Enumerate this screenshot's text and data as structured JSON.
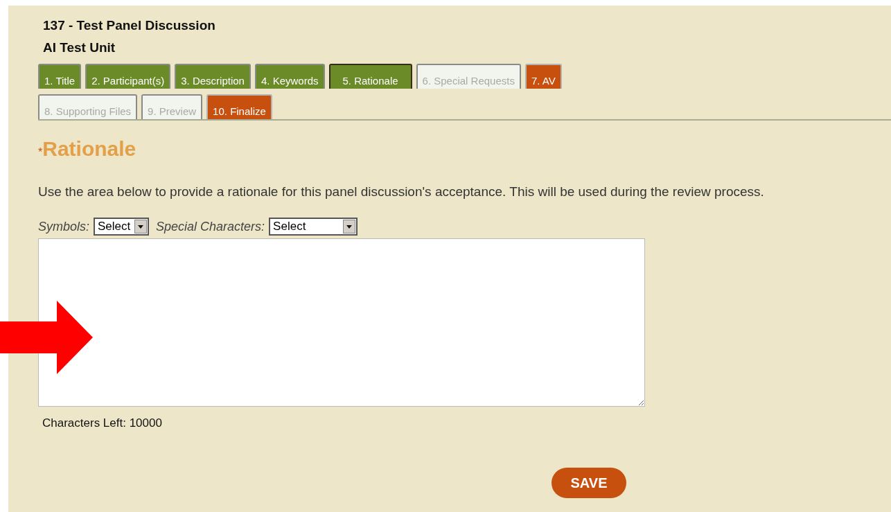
{
  "header": {
    "title": "137 - Test Panel Discussion",
    "subtitle": "AI Test Unit"
  },
  "tab_rows": [
    {
      "tabs": [
        {
          "label": "1. Title",
          "kind": "done",
          "selected": false
        },
        {
          "label": "2. Participant(s)",
          "kind": "done",
          "selected": false
        },
        {
          "label": "3. Description",
          "kind": "done",
          "selected": false
        },
        {
          "label": "4. Keywords",
          "kind": "done",
          "selected": false
        },
        {
          "label": "5. Rationale",
          "kind": "done",
          "selected": true
        },
        {
          "label": "6. Special Requests",
          "kind": "empty",
          "selected": false
        },
        {
          "label": "7. AV",
          "kind": "attention",
          "selected": false
        }
      ]
    },
    {
      "tabs": [
        {
          "label": "8. Supporting Files",
          "kind": "empty",
          "selected": false
        },
        {
          "label": "9. Preview",
          "kind": "empty",
          "selected": false
        },
        {
          "label": "10. Finalize",
          "kind": "attention",
          "selected": false
        }
      ]
    }
  ],
  "section": {
    "required_mark": "*",
    "heading": "Rationale",
    "instructions": "Use the area below to provide a rationale for this panel discussion's acceptance. This will be used during the review process."
  },
  "pickers": [
    {
      "label": "Symbols:",
      "value": "Select"
    },
    {
      "label": "Special Characters:",
      "value": "Select"
    }
  ],
  "characters_left": "Characters Left: 10000",
  "save_button": "SAVE"
}
